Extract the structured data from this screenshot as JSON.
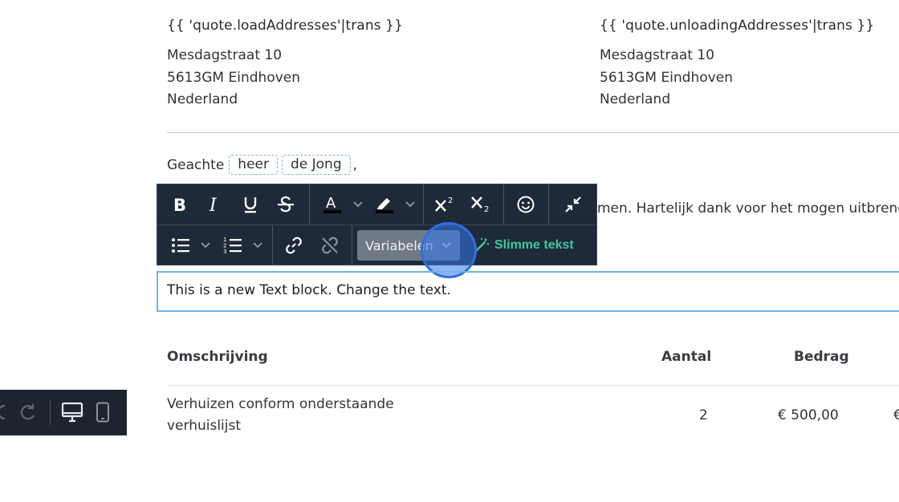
{
  "addresses": {
    "load": {
      "title": "{{ 'quote.loadAddresses'|trans }}",
      "street": "Mesdagstraat 10",
      "city": "5613GM Eindhoven",
      "country": "Nederland"
    },
    "unload": {
      "title": "{{ 'quote.unloadingAddresses'|trans }}",
      "street": "Mesdagstraat 10",
      "city": "5613GM Eindhoven",
      "country": "Nederland"
    }
  },
  "salutation": {
    "greeting": "Geachte",
    "title_var": "heer",
    "name_var": "de Jong",
    "punct": ","
  },
  "paragraph_visible_tail": "men. Hartelijk dank voor het mogen uitbrengen",
  "toolbar": {
    "variables_label": "Variabelen",
    "smart_text_label": "Slimme tekst"
  },
  "text_block": {
    "text": "This is a new Text block. Change the text."
  },
  "table": {
    "headers": {
      "description": "Omschrijving",
      "quantity": "Aantal",
      "amount": "Bedrag"
    },
    "rows": [
      {
        "description_line1": "Verhuizen conform onderstaande",
        "description_line2": "verhuislijst",
        "quantity": "2",
        "amount": "€ 500,00",
        "total_cut": "€"
      }
    ]
  },
  "colors": {
    "toolbar_bg": "#1f2a38",
    "accent_green": "#3fc89a",
    "selection_border": "#6fb6df",
    "cursor": "#2f6fe4"
  }
}
